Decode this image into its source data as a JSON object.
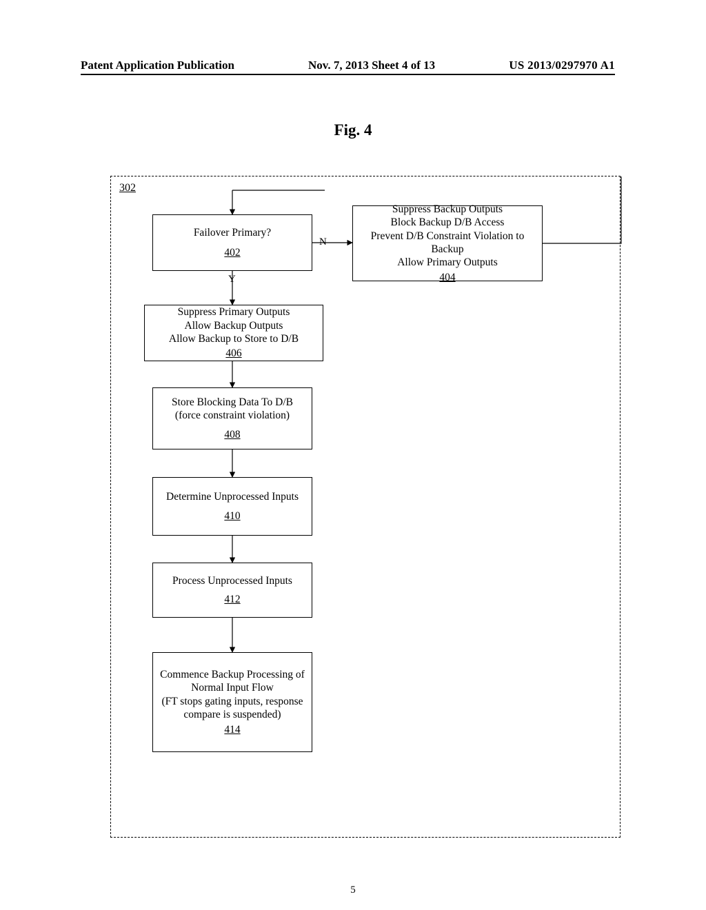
{
  "header": {
    "left": "Patent Application Publication",
    "center": "Nov. 7, 2013  Sheet 4 of 13",
    "right": "US 2013/0297970 A1"
  },
  "figure_label": "Fig. 4",
  "container_ref": "302",
  "labels": {
    "yes": "Y",
    "no": "N"
  },
  "page_number": "5",
  "boxes": {
    "b402": {
      "lines": [
        "Failover Primary?"
      ],
      "ref": "402"
    },
    "b404": {
      "lines": [
        "Suppress Backup Outputs",
        "Block Backup D/B Access",
        "Prevent D/B Constraint Violation to Backup",
        "Allow Primary Outputs"
      ],
      "ref": "404"
    },
    "b406": {
      "lines": [
        "Suppress Primary Outputs",
        "Allow Backup Outputs",
        "Allow Backup to Store to D/B"
      ],
      "ref": "406"
    },
    "b408": {
      "lines": [
        "Store Blocking Data To D/B",
        "(force constraint violation)"
      ],
      "ref": "408"
    },
    "b410": {
      "lines": [
        "Determine Unprocessed Inputs"
      ],
      "ref": "410"
    },
    "b412": {
      "lines": [
        "Process Unprocessed Inputs"
      ],
      "ref": "412"
    },
    "b414": {
      "lines": [
        "Commence Backup Processing of Normal Input Flow",
        "(FT stops gating inputs, response compare is suspended)"
      ],
      "ref": "414"
    }
  },
  "chart_data": {
    "type": "flowchart",
    "nodes": [
      {
        "id": "402",
        "kind": "decision",
        "text": "Failover Primary?"
      },
      {
        "id": "404",
        "kind": "process",
        "text": "Suppress Backup Outputs; Block Backup D/B Access; Prevent D/B Constraint Violation to Backup; Allow Primary Outputs"
      },
      {
        "id": "406",
        "kind": "process",
        "text": "Suppress Primary Outputs; Allow Backup Outputs; Allow Backup to Store to D/B"
      },
      {
        "id": "408",
        "kind": "process",
        "text": "Store Blocking Data To D/B (force constraint violation)"
      },
      {
        "id": "410",
        "kind": "process",
        "text": "Determine Unprocessed Inputs"
      },
      {
        "id": "412",
        "kind": "process",
        "text": "Process Unprocessed Inputs"
      },
      {
        "id": "414",
        "kind": "process",
        "text": "Commence Backup Processing of Normal Input Flow (FT stops gating inputs, response compare is suspended)"
      }
    ],
    "edges": [
      {
        "from": "entry",
        "to": "402"
      },
      {
        "from": "402",
        "to": "404",
        "label": "N"
      },
      {
        "from": "404",
        "to": "402",
        "note": "loops back to decision via top connector"
      },
      {
        "from": "402",
        "to": "406",
        "label": "Y"
      },
      {
        "from": "406",
        "to": "408"
      },
      {
        "from": "408",
        "to": "410"
      },
      {
        "from": "410",
        "to": "412"
      },
      {
        "from": "412",
        "to": "414"
      }
    ],
    "container": "302"
  }
}
